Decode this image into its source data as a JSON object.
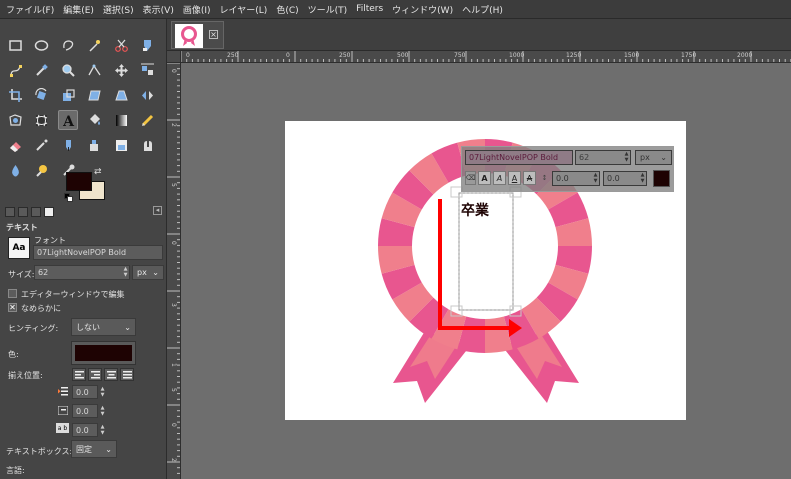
{
  "menubar": {
    "items": [
      "ファイル(F)",
      "編集(E)",
      "選択(S)",
      "表示(V)",
      "画像(I)",
      "レイヤー(L)",
      "色(C)",
      "ツール(T)",
      "Filters",
      "ウィンドウ(W)",
      "ヘルプ(H)"
    ]
  },
  "toolbox": {
    "tools": [
      "rect-select-icon",
      "ellipse-select-icon",
      "free-select-icon",
      "fuzzy-select-icon",
      "scissors-icon",
      "foreground-select-icon",
      "paths-icon",
      "color-picker-icon",
      "zoom-icon",
      "measure-icon",
      "move-icon",
      "align-icon",
      "crop-icon",
      "rotate-icon",
      "scale-icon",
      "shear-icon",
      "perspective-icon",
      "flip-icon",
      "cage-icon",
      "warp-icon",
      "text-icon",
      "bucket-fill-icon",
      "blend-icon",
      "pencil-icon",
      "eraser-icon",
      "airbrush-icon",
      "ink-icon",
      "clone-icon",
      "heal-icon",
      "smudge-icon",
      "blur-icon",
      "dodge-icon",
      "mypaint-brush-icon"
    ],
    "active_tool": "text-icon",
    "fg_color": "#1e0303",
    "bg_color": "#efe4cc"
  },
  "tool_options": {
    "section_title": "テキスト",
    "font_label": "フォント",
    "font_value": "07LightNovelPOP Bold",
    "size_label": "サイズ:",
    "size_value": "62",
    "size_unit": "px",
    "editor_window_label": "エディターウィンドウで編集",
    "antialias_label": "なめらかに",
    "hinting_label": "ヒンティング:",
    "hinting_value": "しない",
    "color_label": "色:",
    "color_value": "#1e0303",
    "justify_label": "揃え位置:",
    "indent_value": "0.0",
    "line_spacing_value": "0.0",
    "letter_spacing_value": "0.0",
    "textbox_label": "テキストボックス:",
    "textbox_value": "固定",
    "language_label": "言語:"
  },
  "image_tab": {
    "close_label": "×"
  },
  "ruler": {
    "top_labels": [
      "0",
      "250",
      "0",
      "250",
      "500",
      "750",
      "1000",
      "1250",
      "1500",
      "1750",
      "2000"
    ],
    "left_labels": [
      "0",
      "2",
      "5",
      "0",
      "3",
      "1",
      "5",
      "0",
      "2"
    ]
  },
  "canvas": {
    "text_content": "卒業",
    "text_toolbar": {
      "font_value": "07LightNovelPOP Bold",
      "size_value": "62",
      "unit": "px",
      "kerning_value": "0.0",
      "baseline_value": "0.0",
      "color": "#1e0303"
    },
    "ribbon_colors": {
      "dark": "#e8568f",
      "light": "#f07f8c"
    },
    "arrow_color": "#ff0000"
  }
}
